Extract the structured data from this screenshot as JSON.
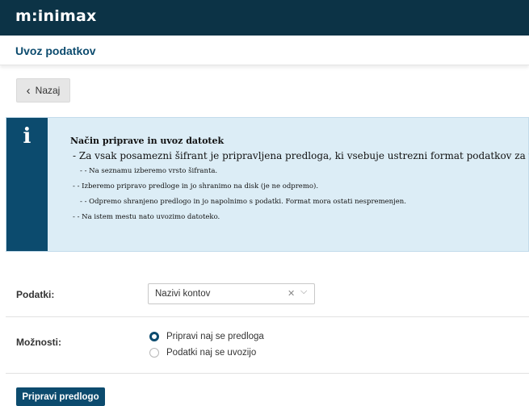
{
  "app": {
    "logo_text": "m:inimax"
  },
  "header": {
    "title": "Uvoz podatkov"
  },
  "toolbar": {
    "back_label": "Nazaj"
  },
  "info": {
    "title": "Način priprave in uvoz datotek",
    "lead": "- Za vsak posamezni šifrant je pripravljena predloga, ki vsebuje ustrezni format podatkov za uvoz.",
    "lines": [
      "- - Na seznamu izberemo vrsto šifranta.",
      "- - Izberemo pripravo predloge in jo shranimo na disk (je ne odpremo).",
      "- - Odpremo shranjeno predlogo in jo napolnimo s podatki. Format mora ostati nespremenjen.",
      "- - Na istem mestu nato uvozimo datoteko."
    ]
  },
  "form": {
    "data_label": "Podatki:",
    "data_value": "Nazivi kontov",
    "options_label": "Možnosti:",
    "options": [
      {
        "label": "Pripravi naj se predloga",
        "selected": true
      },
      {
        "label": "Podatki naj se uvozijo",
        "selected": false
      }
    ],
    "submit_label": "Pripravi predlogo"
  },
  "colors": {
    "topbar": "#0c3346",
    "accent": "#0c4b6e",
    "info_bg": "#dcedf6"
  },
  "icons": {
    "back": "chevron-left-icon",
    "info": "info-icon",
    "clear": "clear-icon",
    "dropdown": "chevron-down-icon"
  }
}
